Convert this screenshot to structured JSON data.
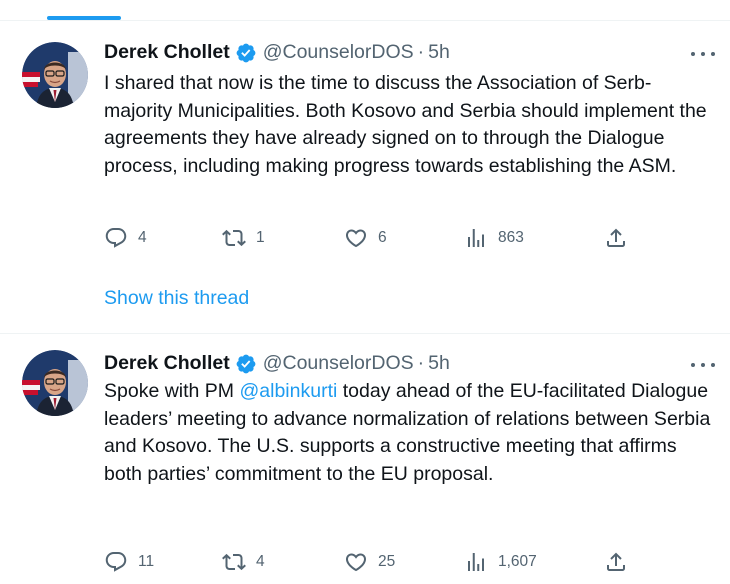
{
  "tweets": [
    {
      "author": {
        "name": "Derek Chollet",
        "handle": "@CounselorDOS",
        "separator": "·",
        "time": "5h"
      },
      "text": "I shared that now is the time to discuss the Association of Serb-majority Municipalities. Both Kosovo and Serbia should implement the agreements they have already signed on to through the Dialogue process, including making progress towards establishing the ASM.",
      "stats": {
        "replies": "4",
        "retweets": "1",
        "likes": "6",
        "views": "863"
      },
      "show_thread": "Show this thread"
    },
    {
      "author": {
        "name": "Derek Chollet",
        "handle": "@CounselorDOS",
        "separator": "·",
        "time": "5h"
      },
      "text_before_mention": "Spoke with PM ",
      "mention": "@albinkurti",
      "text_after_mention": " today ahead of the EU-facilitated Dialogue leaders’ meeting to advance normalization of relations between Serbia and Kosovo. The U.S. supports a constructive meeting that affirms both parties’ commitment to the EU proposal.",
      "stats": {
        "replies": "11",
        "retweets": "4",
        "likes": "25",
        "views": "1,607"
      }
    }
  ],
  "colors": {
    "accent": "#1d9bf0",
    "text_primary": "#0f1419",
    "text_secondary": "#536471",
    "divider": "#eff3f4"
  },
  "icons": [
    "verified-badge-icon",
    "more-icon",
    "reply-icon",
    "retweet-icon",
    "like-icon",
    "views-icon",
    "share-icon"
  ]
}
